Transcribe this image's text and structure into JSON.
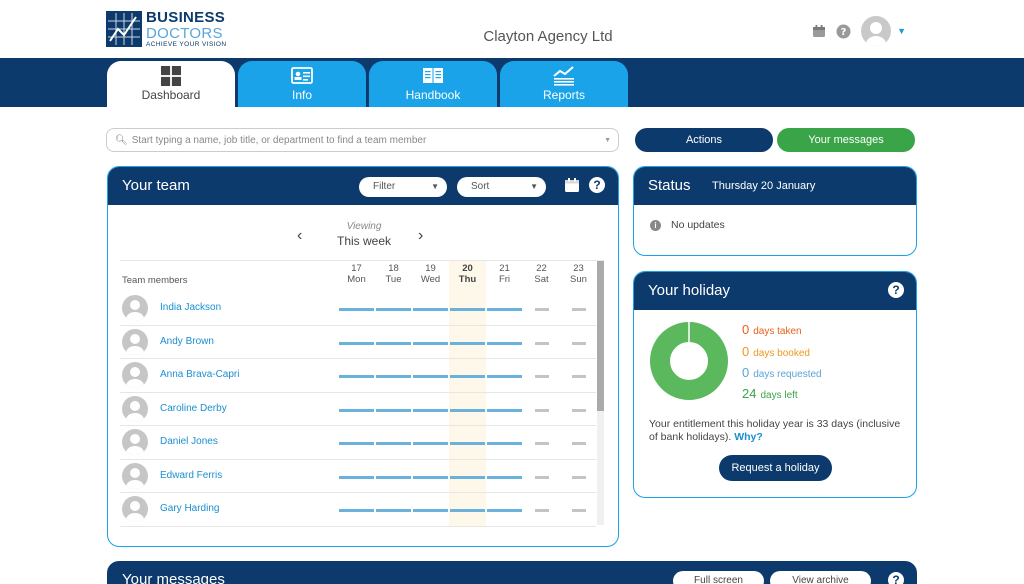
{
  "brand": {
    "line1": "BUSINESS",
    "line2": "DOCTORS",
    "tagline": "ACHIEVE YOUR VISION",
    "primary": "#0d3a6c",
    "accent": "#1aa3e8",
    "green": "#3aa548"
  },
  "header": {
    "company": "Clayton Agency Ltd",
    "icons": [
      "calendar-icon",
      "help-icon",
      "avatar",
      "caret-down-icon"
    ]
  },
  "tabs": [
    {
      "label": "Dashboard",
      "icon": "grid-icon",
      "active": true
    },
    {
      "label": "Info",
      "icon": "id-card-icon"
    },
    {
      "label": "Handbook",
      "icon": "book-icon"
    },
    {
      "label": "Reports",
      "icon": "chart-icon"
    }
  ],
  "search": {
    "placeholder": "Start typing a name, job title, or department to find a team member"
  },
  "buttons": {
    "actions": "Actions",
    "messages": "Your messages"
  },
  "team": {
    "title": "Your team",
    "filter": "Filter",
    "sort": "Sort",
    "viewing_label": "Viewing",
    "viewing_value": "This week",
    "members_header": "Team members",
    "days": [
      {
        "num": "17",
        "name": "Mon"
      },
      {
        "num": "18",
        "name": "Tue"
      },
      {
        "num": "19",
        "name": "Wed"
      },
      {
        "num": "20",
        "name": "Thu",
        "today": true
      },
      {
        "num": "21",
        "name": "Fri"
      },
      {
        "num": "22",
        "name": "Sat"
      },
      {
        "num": "23",
        "name": "Sun"
      }
    ],
    "members": [
      "India Jackson",
      "Andy Brown",
      "Anna Brava-Capri",
      "Caroline Derby",
      "Daniel Jones",
      "Edward Ferris",
      "Gary Harding"
    ]
  },
  "status": {
    "title": "Status",
    "date": "Thursday 20 January",
    "message": "No updates"
  },
  "holiday": {
    "title": "Your holiday",
    "stats": [
      {
        "value": "0",
        "label": "days taken",
        "color": "#e8601c"
      },
      {
        "value": "0",
        "label": "days booked",
        "color": "#f0961e"
      },
      {
        "value": "0",
        "label": "days requested",
        "color": "#5aa5d8"
      },
      {
        "value": "24",
        "label": "days left",
        "color": "#3aa548"
      }
    ],
    "entitlement": "Your entitlement this holiday year is 33 days (inclusive of bank holidays).",
    "why": "Why?",
    "request_button": "Request a holiday"
  },
  "messages_panel": {
    "title": "Your messages",
    "full_screen": "Full screen",
    "view_archive": "View archive"
  }
}
